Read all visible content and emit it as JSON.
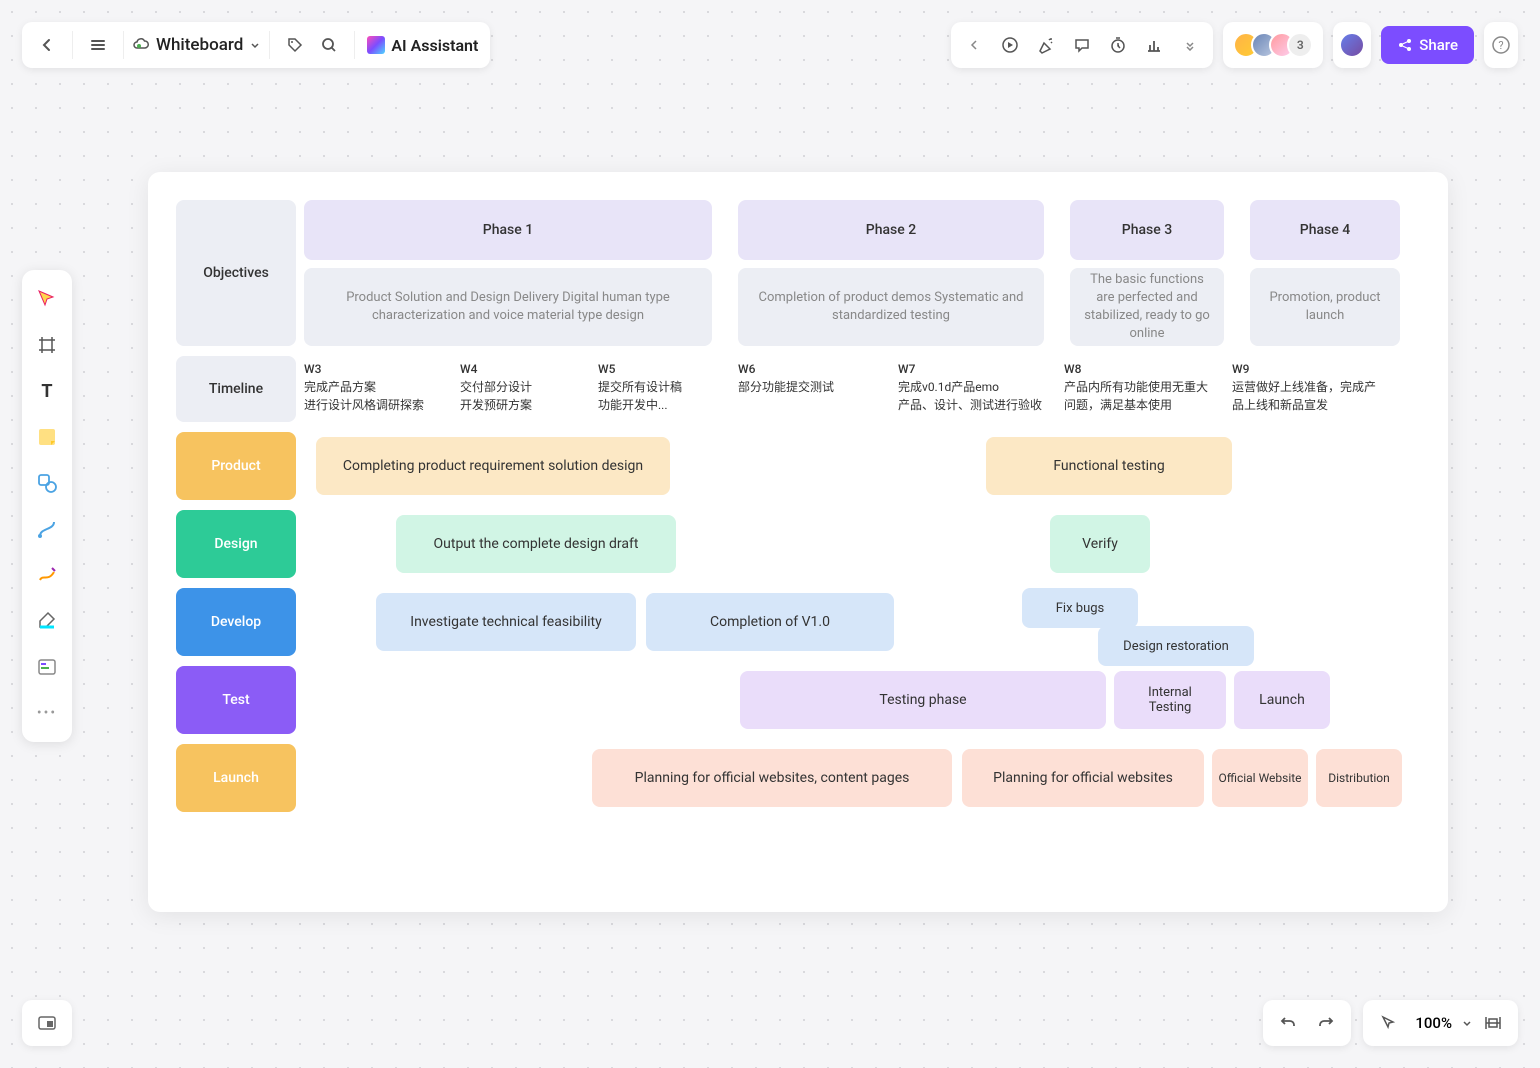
{
  "header": {
    "title": "Whiteboard",
    "ai_label": "AI Assistant",
    "avatar_count": "3",
    "share_label": "Share"
  },
  "zoom": "100%",
  "phases": {
    "p1": "Phase 1",
    "p2": "Phase 2",
    "p3": "Phase 3",
    "p4": "Phase 4"
  },
  "objectives_label": "Objectives",
  "phase_descs": {
    "d1": "Product Solution and Design Delivery Digital human type characterization and voice material type design",
    "d2": "Completion of product demos Systematic and standardized testing",
    "d3": "The basic functions are perfected and stabilized, ready to go online",
    "d4": "Promotion, product launch"
  },
  "timeline_label": "Timeline",
  "weeks": {
    "w3": {
      "wk": "W3",
      "l1": "完成产品方案",
      "l2": "进行设计风格调研探索"
    },
    "w4": {
      "wk": "W4",
      "l1": "交付部分设计",
      "l2": "开发预研方案"
    },
    "w5": {
      "wk": "W5",
      "l1": "提交所有设计稿",
      "l2": "功能开发中..."
    },
    "w6": {
      "wk": "W6",
      "l1": "部分功能提交测试",
      "l2": ""
    },
    "w7": {
      "wk": "W7",
      "l1": "完成v0.1d产品emo",
      "l2": "产品、设计、测试进行验收"
    },
    "w8": {
      "wk": "W8",
      "l1": "产品内所有功能使用无重大问题，满足基本使用",
      "l2": ""
    },
    "w9": {
      "wk": "W9",
      "l1": "运营做好上线准备，完成产品上线和新品宣发",
      "l2": ""
    }
  },
  "tracks": {
    "product": {
      "label": "Product",
      "t1": "Completing product requirement solution design",
      "t2": "Functional testing"
    },
    "design": {
      "label": "Design",
      "t1": "Output the complete design draft",
      "t2": "Verify"
    },
    "develop": {
      "label": "Develop",
      "t1": "Investigate technical feasibility",
      "t2": "Completion of V1.0",
      "t3": "Fix bugs",
      "t4": "Design restoration"
    },
    "test": {
      "label": "Test",
      "t1": "Testing phase",
      "t2": "Internal Testing",
      "t3": "Launch"
    },
    "launch": {
      "label": "Launch",
      "t1": "Planning for official websites, content pages",
      "t2": "Planning for official websites",
      "t3": "Official Website",
      "t4": "Distribution"
    }
  }
}
